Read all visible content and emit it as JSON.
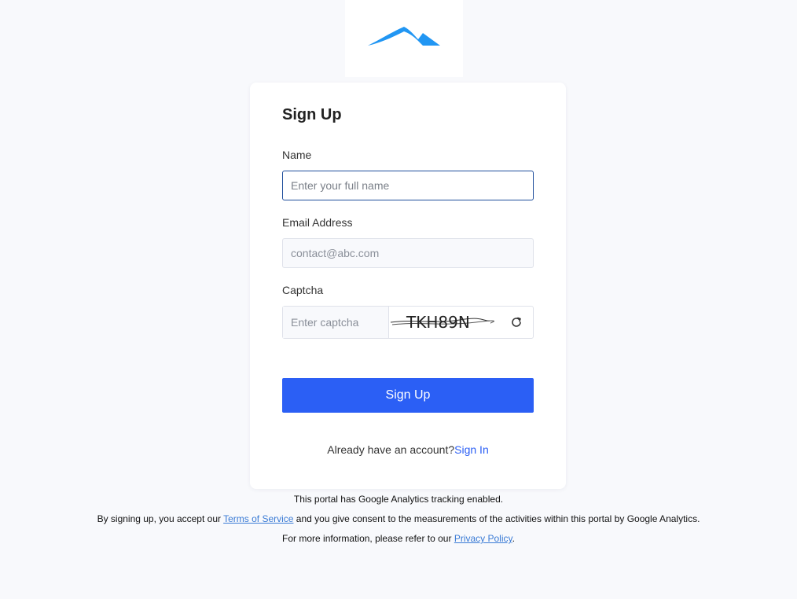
{
  "logo": {
    "icon": "mountain-logo-icon",
    "color": "#2196f3"
  },
  "form": {
    "title": "Sign Up",
    "name": {
      "label": "Name",
      "placeholder": "Enter your full name",
      "value": ""
    },
    "email": {
      "label": "Email Address",
      "placeholder": "contact@abc.com",
      "value": ""
    },
    "captcha": {
      "label": "Captcha",
      "placeholder": "Enter captcha",
      "image_text": "TKH89N",
      "refresh_icon": "refresh-icon"
    },
    "submit_label": "Sign Up",
    "signin_prompt": "Already have an account?",
    "signin_link": "Sign In"
  },
  "footer": {
    "line1": "This portal has Google Analytics tracking enabled.",
    "line2_before": "By signing up, you accept our ",
    "line2_link": "Terms of Service",
    "line2_after": " and you give consent to the measurements of the activities within this portal by Google Analytics.",
    "line3_before": "For more information, please refer to our ",
    "line3_link": "Privacy Policy",
    "line3_after": "."
  },
  "colors": {
    "primary": "#2b5ff5",
    "focus_border": "#1f4e9c",
    "link": "#2b5ff5",
    "background": "#f8f9fc"
  }
}
